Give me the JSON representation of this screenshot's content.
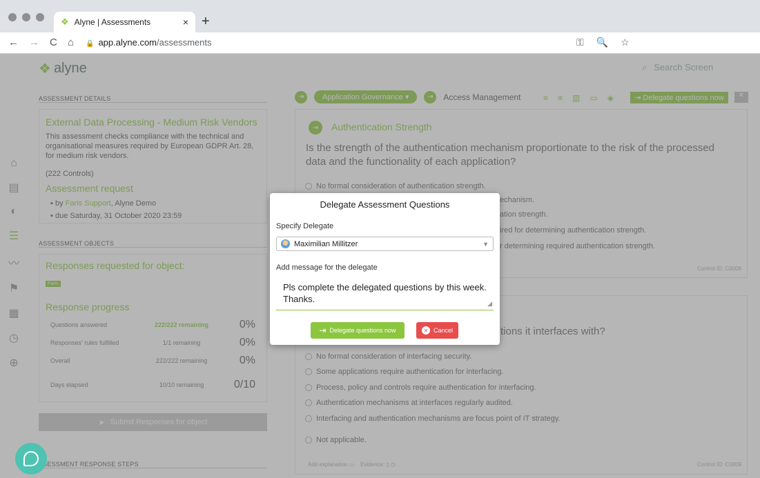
{
  "browser": {
    "tab_title": "Alyne | Assessments",
    "tab_close": "×",
    "new_tab": "+",
    "url_domain": "app.alyne.com",
    "url_path": "/assessments",
    "nav": {
      "back": "←",
      "forward": "→",
      "reload": "C",
      "home": "⌂",
      "lock": "🔒"
    },
    "icons": {
      "key": "⚿",
      "zoom": "🔍",
      "star": "☆"
    }
  },
  "app": {
    "logo": "alyne",
    "search_placeholder": "Search Screen",
    "assessment_details_heading": "ASSESSMENT DETAILS",
    "assessment_title": "External Data Processing - Medium Risk Vendors",
    "assessment_description": "This assessment checks compliance with the technical and organisational measures required by European GDPR Art. 28, for medium risk vendors.",
    "controls_count": "(222 Controls)",
    "request_heading": "Assessment request",
    "request_by_prefix": "by",
    "request_by_name": "Faris Support",
    "request_by_org": ", Alyne Demo",
    "request_due": "due Saturday, 31 October 2020 23:59",
    "objects_heading": "ASSESSMENT OBJECTS",
    "responses_requested": "Responses requested for object:",
    "object_tag": "Faris",
    "response_progress": "Response progress",
    "progress": [
      {
        "label": "Questions answered",
        "remaining": "222/222 remaining",
        "pct": "0%"
      },
      {
        "label": "Responses' rules fulfilled",
        "remaining": "1/1 remaining",
        "pct": "0%"
      },
      {
        "label": "Overall",
        "remaining": "222/222 remaining",
        "pct": "0%"
      },
      {
        "label": "Days elapsed",
        "remaining": "10/10 remaining",
        "pct": "0/10"
      }
    ],
    "submit_label": "Submit Responses for object",
    "response_steps_heading": "SSESSMENT RESPONSE STEPS"
  },
  "main": {
    "domain_pill": "Application Governance ▾",
    "subdomain": "Access Management",
    "delegate_top": "Delegate questions now",
    "control_title": "Authentication Strength",
    "question": "Is the strength of the authentication mechanism proportionate to the risk of the processed data and the functionality of each application?",
    "options_1": [
      "No formal consideration of authentication strength.",
      "echanism.",
      "ation strength.",
      "ired for determining authentication strength.",
      "r determining required authentication strength."
    ],
    "control_id_1": "Control ID: C0008",
    "question_2_tail": "tions it interfaces with?",
    "options_2": [
      "No formal consideration of interfacing security.",
      "Some applications require authentication for interfacing.",
      "Process, policy and controls require authentication for interfacing.",
      "Authentication mechanisms at interfaces regularly audited.",
      "Interfacing and authentication mechanisms are focus point of IT strategy."
    ],
    "not_applicable": "Not applicable.",
    "add_explanation": "Add explanation",
    "evidence": "Evidence:",
    "control_id_2": "Control ID: C0009"
  },
  "modal": {
    "title": "Delegate Assessment Questions",
    "delegate_label": "Specify Delegate",
    "delegate_value": "Maximilian Millitzer",
    "message_label": "Add message for the delegate",
    "message_value": "Pls complete the delegated questions by this week. Thanks.",
    "submit_label": "Delegate questions now",
    "cancel_label": "Cancel"
  },
  "colors": {
    "accent": "#8cc63f",
    "danger": "#e84d4d",
    "chat": "#4fc3b1"
  }
}
